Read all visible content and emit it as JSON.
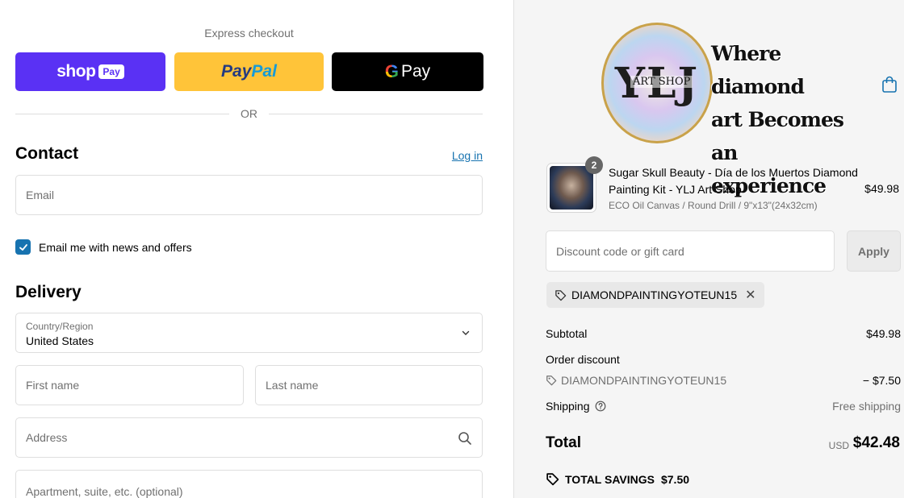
{
  "express": {
    "title": "Express checkout",
    "shop_label": "shop",
    "shop_pay_label": "Pay",
    "paypal_part1": "Pay",
    "paypal_part2": "Pal",
    "gpay_g": "G",
    "gpay_label": "Pay",
    "or_label": "OR"
  },
  "contact": {
    "title": "Contact",
    "login_label": "Log in",
    "email_placeholder": "Email",
    "newsletter_label": "Email me with news and offers",
    "newsletter_checked": true
  },
  "delivery": {
    "title": "Delivery",
    "country_label": "Country/Region",
    "country_value": "United States",
    "first_name_placeholder": "First name",
    "last_name_placeholder": "Last name",
    "address_placeholder": "Address",
    "apartment_placeholder": "Apartment, suite, etc. (optional)"
  },
  "brand": {
    "logo_letters": "YLJ",
    "logo_sub": "ART SHOP",
    "tagline_1": "Where diamond",
    "tagline_2": "art Becomes",
    "tagline_3": "an experience"
  },
  "cart": {
    "quantity": "2",
    "product_name": "Sugar Skull Beauty - Día de los Muertos Diamond Painting Kit - YLJ Art Shop",
    "variant": "ECO Oil Canvas / Round Drill / 9\"x13\"(24x32cm)",
    "price": "$49.98"
  },
  "discount": {
    "placeholder": "Discount code or gift card",
    "apply_label": "Apply",
    "applied_code": "DIAMONDPAINTINGYOTEUN15"
  },
  "summary": {
    "subtotal_label": "Subtotal",
    "subtotal_value": "$49.98",
    "order_discount_label": "Order discount",
    "discount_code": "DIAMONDPAINTINGYOTEUN15",
    "discount_value": "− $7.50",
    "shipping_label": "Shipping",
    "shipping_value": "Free shipping",
    "total_label": "Total",
    "currency": "USD",
    "total_value": "$42.48",
    "savings_label": "TOTAL SAVINGS",
    "savings_value": "$7.50"
  },
  "colors": {
    "shop_pay": "#5a31f4",
    "paypal": "#ffc439",
    "gpay": "#000000",
    "link": "#1773b0"
  }
}
